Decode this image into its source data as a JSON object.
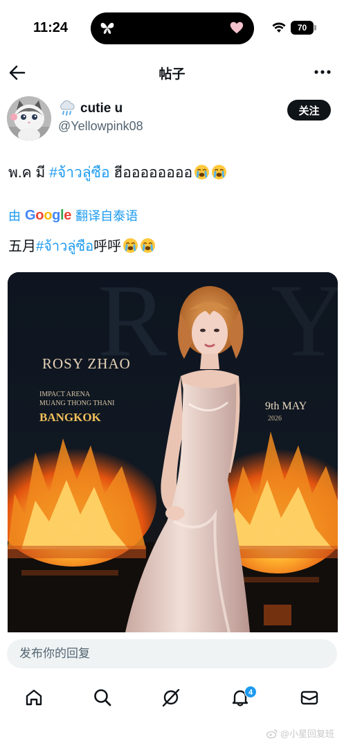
{
  "status_bar": {
    "time": "11:24",
    "battery": "70"
  },
  "header": {
    "title": "帖子"
  },
  "author": {
    "display_name": "cutie u",
    "handle": "@Yellowpink08",
    "follow_label": "关注"
  },
  "post": {
    "text_parts": [
      "พ.ค มี ",
      "#จ้าวลู่ซือ",
      " ฮีออออออออ"
    ],
    "translate_prefix": "由",
    "translate_brand": "Google",
    "translate_suffix": "翻译自泰语",
    "translated_parts": [
      "五月",
      "#จ้าวลู่ซือ",
      "呼呼"
    ]
  },
  "poster": {
    "artist": "ROSY ZHAO",
    "venue_line1": "IMPACT ARENA",
    "venue_line2": "MUANG THONG THANI",
    "city": "BANGKOK",
    "date": "9th MAY",
    "year": "2026"
  },
  "reply": {
    "placeholder": "发布你的回复"
  },
  "nav": {
    "notification_count": "4"
  },
  "watermark": "@小星回复班",
  "colors": {
    "accent": "#1d9bf0",
    "text": "#0f1419",
    "muted": "#536471"
  }
}
